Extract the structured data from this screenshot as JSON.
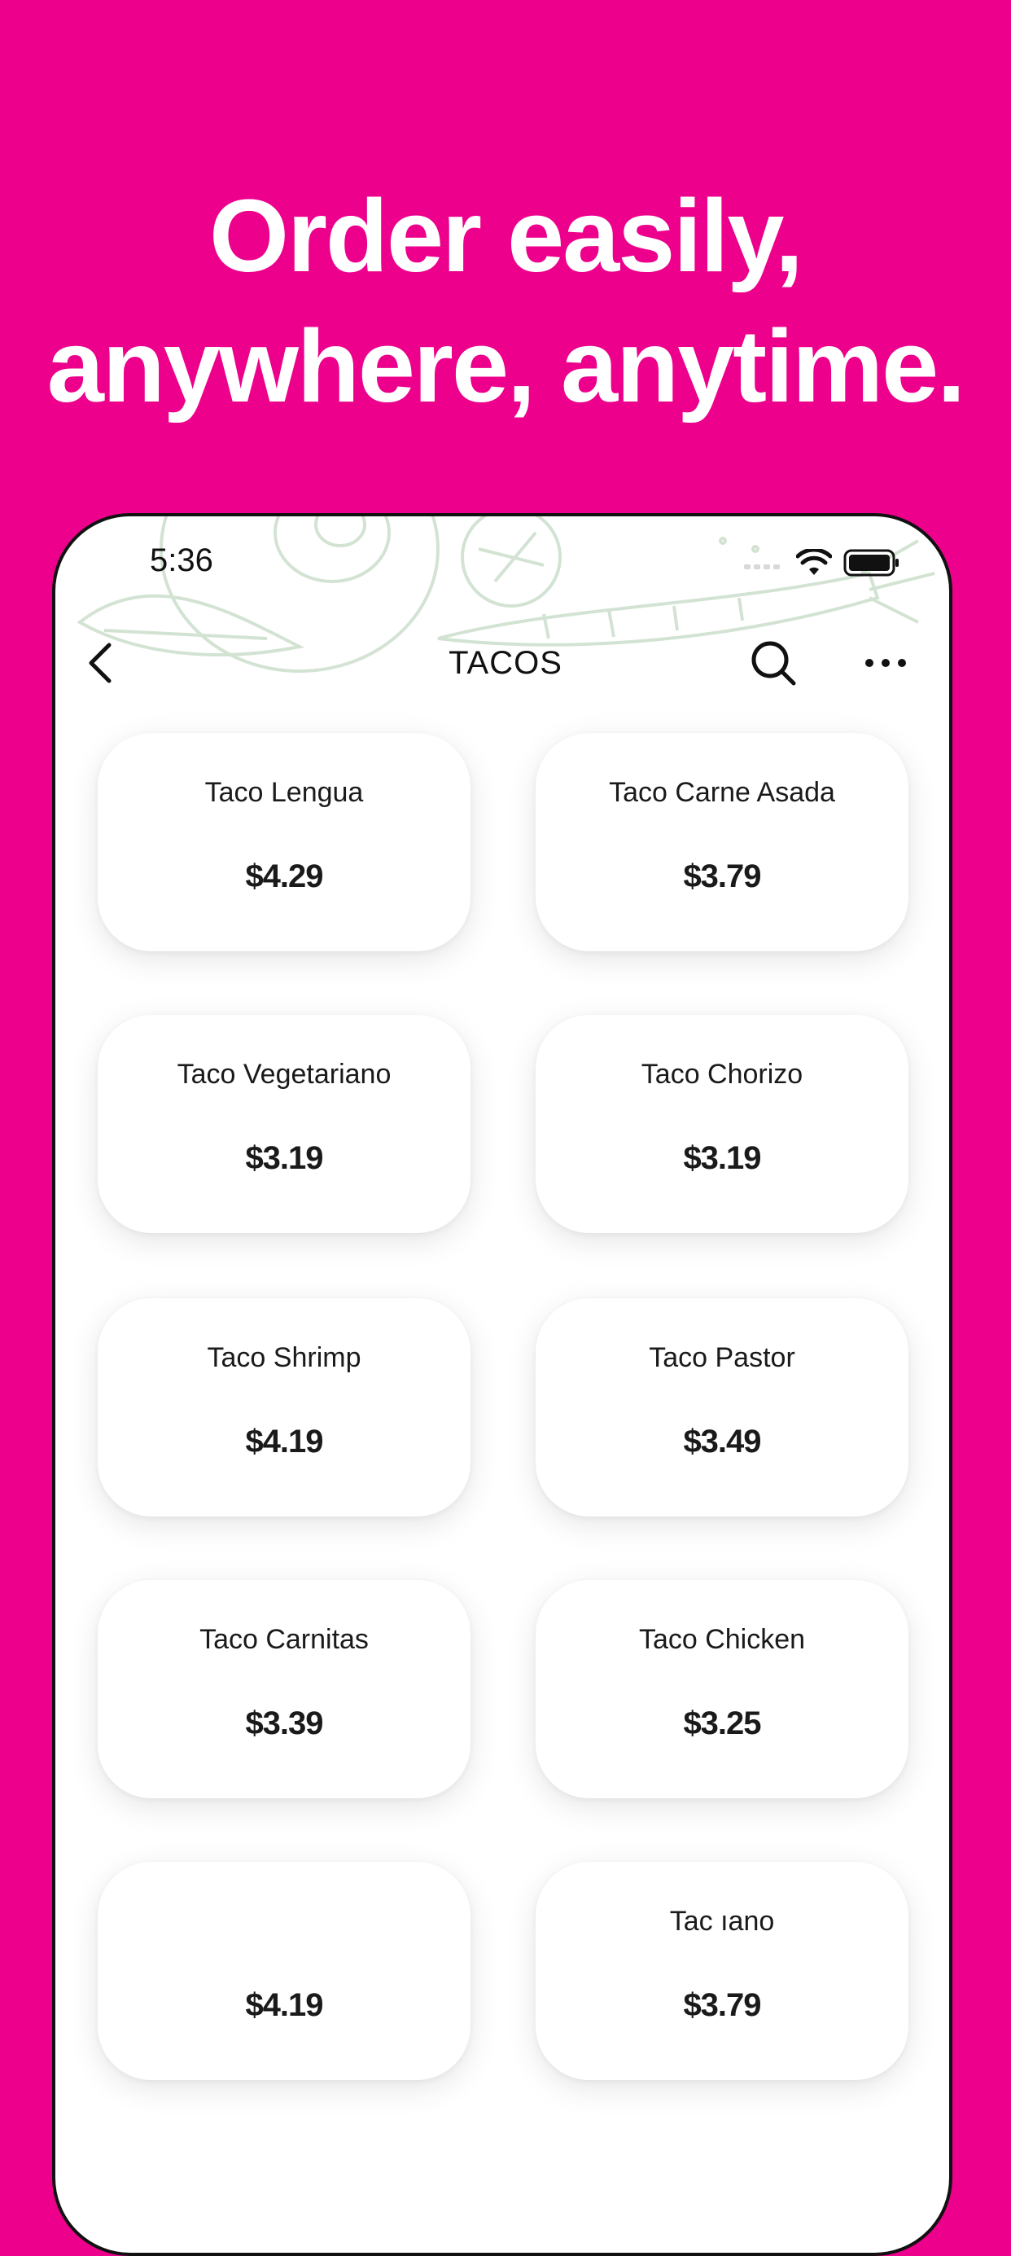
{
  "headline": {
    "line1": "Order easily,",
    "line2": "anywhere, anytime."
  },
  "status_bar": {
    "time": "5:36",
    "icons": [
      "signal-icon",
      "wifi-icon",
      "battery-icon"
    ]
  },
  "nav": {
    "title": "TACOS",
    "back_icon": "chevron-left-icon",
    "search_icon": "search-icon",
    "more_icon": "more-icon"
  },
  "menu_items": [
    {
      "name": "Taco Lengua",
      "price": "$4.29"
    },
    {
      "name": "Taco Carne Asada",
      "price": "$3.79"
    },
    {
      "name": "Taco Vegetariano",
      "price": "$3.19"
    },
    {
      "name": "Taco Chorizo",
      "price": "$3.19"
    },
    {
      "name": "Taco Shrimp",
      "price": "$4.19"
    },
    {
      "name": "Taco Pastor",
      "price": "$3.49"
    },
    {
      "name": "Taco Carnitas",
      "price": "$3.39"
    },
    {
      "name": "Taco Chicken",
      "price": "$3.25"
    },
    {
      "name": "",
      "price": "$4.19"
    },
    {
      "name": "Tac           ıano",
      "price": "$3.79"
    }
  ],
  "colors": {
    "background": "#EC008C",
    "headline_text": "#FFFFFF",
    "card": "#FFFFFF",
    "text": "#1A1A1A",
    "illustration": "#D9E8D9"
  }
}
